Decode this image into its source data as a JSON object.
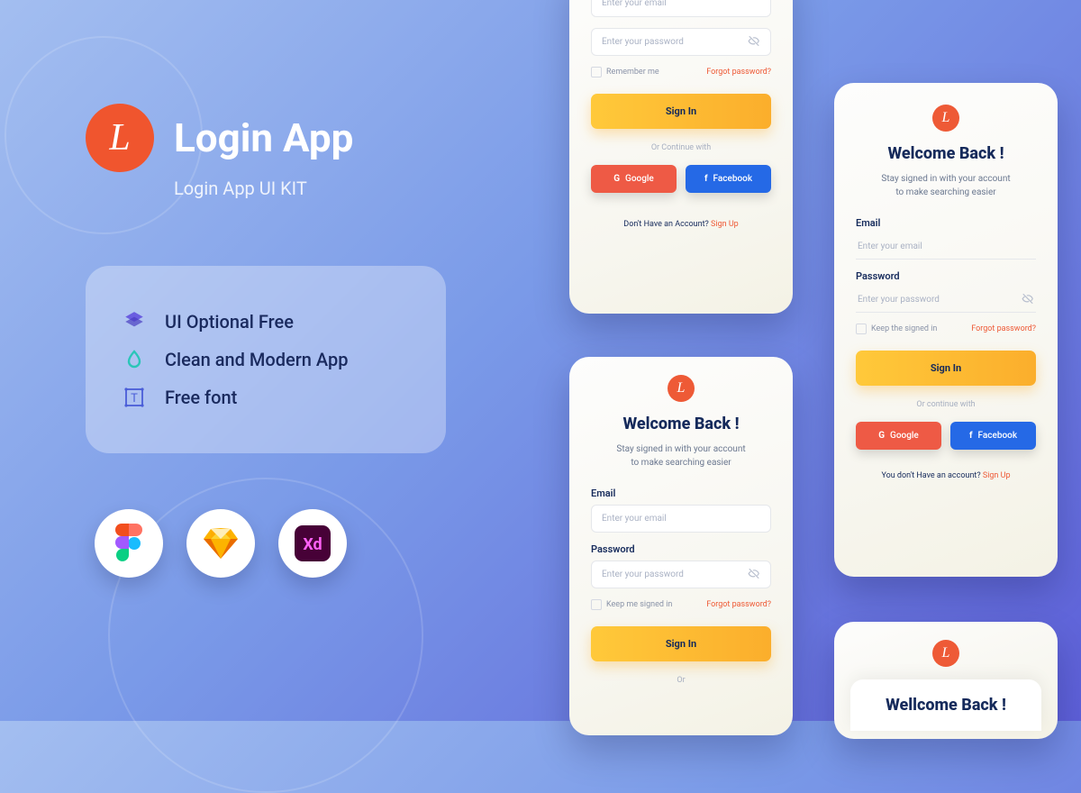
{
  "hero": {
    "title": "Login App",
    "subtitle": "Login App UI KIT"
  },
  "features": [
    {
      "text": "UI Optional Free"
    },
    {
      "text": "Clean and Modern App"
    },
    {
      "text": "Free font"
    }
  ],
  "screen1": {
    "email_ph": "Enter your email",
    "pw_ph": "Enter your password",
    "remember": "Remember me",
    "forgot": "Forgot password?",
    "signin": "Sign In",
    "continue": "Or Continue with",
    "google": "Google",
    "facebook": "Facebook",
    "footer_q": "Don't Have an Account? ",
    "footer_link": "Sign Up"
  },
  "screen2": {
    "title": "Welcome Back !",
    "sub1": "Stay signed in with your account",
    "sub2": "to make searching easier",
    "email_lbl": "Email",
    "email_ph": "Enter your email",
    "pw_lbl": "Password",
    "pw_ph": "Enter your password",
    "keep": "Keep me signed in",
    "forgot": "Forgot password?",
    "signin": "Sign In",
    "or": "Or"
  },
  "screen3": {
    "title": "Welcome Back !",
    "sub1": "Stay signed in with your account",
    "sub2": "to make searching easier",
    "email_lbl": "Email",
    "email_ph": "Enter your email",
    "pw_lbl": "Password",
    "pw_ph": "Enter your password",
    "keep": "Keep the signed in",
    "forgot": "Forgot password?",
    "signin": "Sign In",
    "continue": "Or continue with",
    "google": "Google",
    "facebook": "Facebook",
    "footer_q": "You don't Have an account? ",
    "footer_link": "Sign Up"
  },
  "screen4": {
    "title": "Wellcome Back !"
  }
}
